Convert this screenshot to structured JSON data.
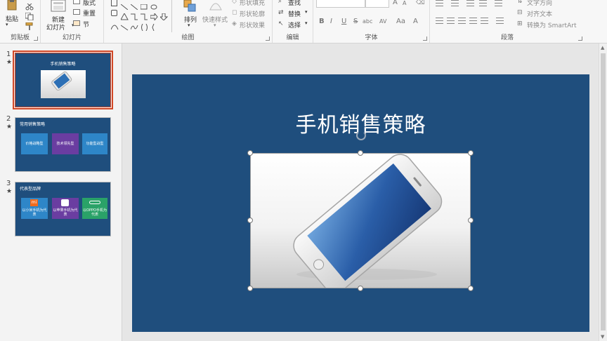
{
  "ribbon": {
    "clipboard": {
      "label": "剪贴板",
      "paste_label": "粘贴"
    },
    "slides": {
      "label": "幻灯片",
      "new_slide_line1": "新建",
      "new_slide_line2": "幻灯片",
      "layout": "版式",
      "reset": "重置",
      "section": "节"
    },
    "drawing": {
      "label": "绘图",
      "arrange": "排列",
      "quick_styles": "快速样式",
      "shape_fill": "形状填充",
      "shape_outline": "形状轮廓",
      "shape_effects": "形状效果"
    },
    "editing": {
      "label": "编辑",
      "find": "查找",
      "replace": "替换",
      "select": "选择"
    },
    "font": {
      "label": "字体",
      "bold": "B",
      "italic": "I",
      "underline": "U",
      "strike": "S",
      "shadow": "abc",
      "spacing": "AV",
      "case": "Aa",
      "grow": "A",
      "shrink": "A",
      "color": "A"
    },
    "paragraph": {
      "label": "段落",
      "text_direction": "文字方向",
      "align_text": "对齐文本",
      "convert_smartart": "转换为 SmartArt"
    }
  },
  "thumbnails": [
    {
      "number": "1",
      "marker": "★",
      "title": "手机销售策略",
      "selected": true
    },
    {
      "number": "2",
      "marker": "★",
      "title": "常用销售策略",
      "boxes": [
        "价格战略型",
        "技术领先型",
        "功能型战型"
      ]
    },
    {
      "number": "3",
      "marker": "★",
      "title": "代表型品牌",
      "boxes": [
        "以小米手机为代表",
        "以苹果手机为代表",
        "以OPPO手机为代表"
      ],
      "logos": [
        "mi"
      ]
    }
  ],
  "slide": {
    "title": "手机销售策略"
  },
  "colors": {
    "slide_bg": "#1f4e7d",
    "selection_outline": "#d24726",
    "tile_blue": "#2e86c8",
    "tile_purple": "#6a3da1",
    "tile_green": "#2aa268"
  }
}
